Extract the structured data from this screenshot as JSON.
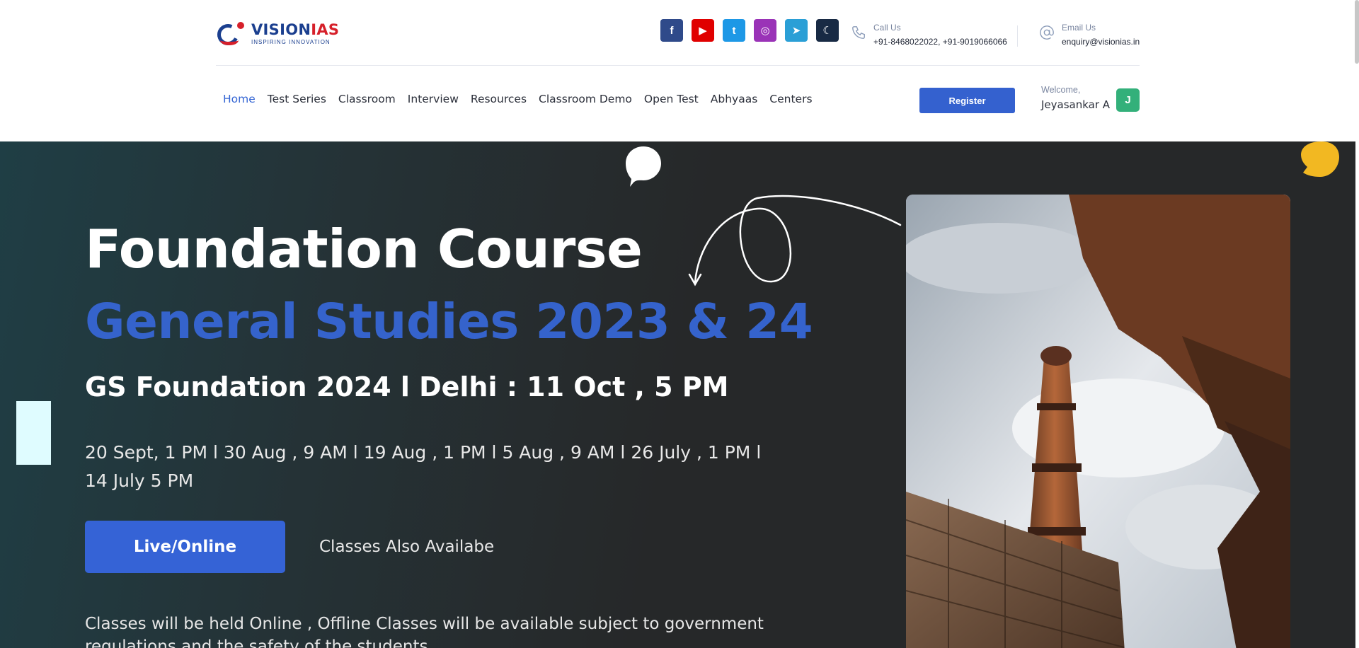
{
  "brand": {
    "name_part1": "VISION",
    "name_part2": "IAS",
    "tagline": "INSPIRING INNOVATION",
    "colors": {
      "blue": "#1b3f8f",
      "red": "#d6202a"
    }
  },
  "socials": [
    {
      "name": "facebook-icon",
      "color": "#2f4a8a",
      "glyph": "f"
    },
    {
      "name": "youtube-icon",
      "color": "#e00000",
      "glyph": "▶"
    },
    {
      "name": "twitter-icon",
      "color": "#1d98e6",
      "glyph": "t"
    },
    {
      "name": "instagram-icon",
      "color": "#9a33b7",
      "glyph": "◎"
    },
    {
      "name": "telegram-icon",
      "color": "#2a9fd6",
      "glyph": "➤"
    },
    {
      "name": "dark-mode-icon",
      "color": "#182a44",
      "glyph": "☾"
    }
  ],
  "contact": {
    "call_label": "Call Us",
    "call_value": "+91-8468022022, +91-9019066066",
    "email_label": "Email Us",
    "email_value": "enquiry@visionias.in"
  },
  "nav": {
    "items": [
      "Home",
      "Test Series",
      "Classroom",
      "Interview",
      "Resources",
      "Classroom Demo",
      "Open Test",
      "Abhyaas",
      "Centers"
    ],
    "active_index": 0
  },
  "user": {
    "register_label": "Register",
    "welcome_label": "Welcome,",
    "name": "Jeyasankar A",
    "avatar_initial": "J",
    "avatar_color": "#33b07a"
  },
  "hero": {
    "title": "Foundation Course",
    "subtitle": "General Studies 2023 & 24",
    "batch": "GS Foundation 2024 l Delhi : 11 Oct , 5 PM",
    "dates": "20 Sept, 1 PM l  30 Aug , 9 AM l 19 Aug , 1 PM l 5 Aug , 9 AM l 26 July , 1 PM l 14 July 5 PM",
    "cta_label": "Live/Online",
    "cta_secondary": "Classes Also Availabe",
    "note": "Classes will be held Online , Offline Classes will be available subject to government regulations and the safety of the students",
    "colors": {
      "accent": "#3563cc",
      "cta": "#3563d6"
    }
  }
}
